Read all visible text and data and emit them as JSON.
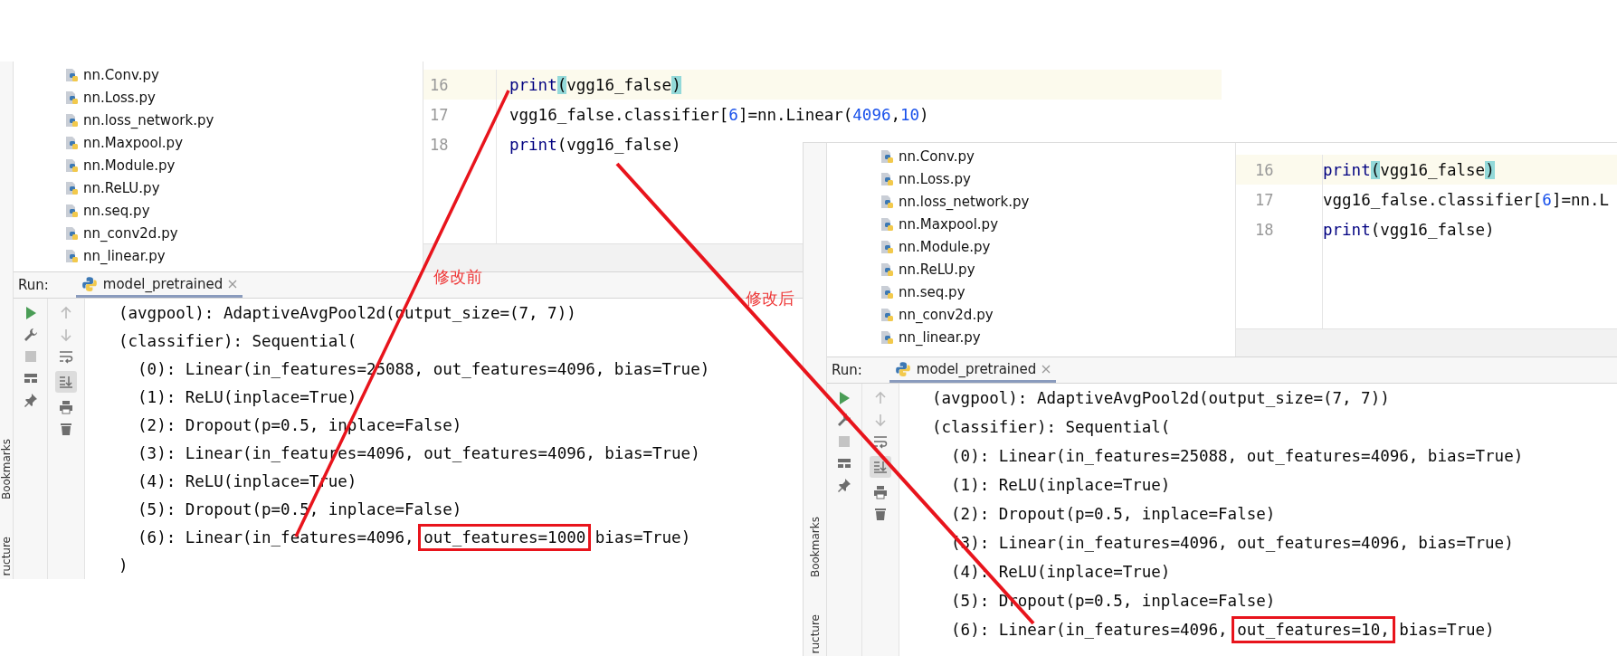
{
  "panels": [
    {
      "project_files": [
        {
          "name": "nn.Conv.py"
        },
        {
          "name": "nn.Loss.py"
        },
        {
          "name": "nn.loss_network.py"
        },
        {
          "name": "nn.Maxpool.py"
        },
        {
          "name": "nn.Module.py"
        },
        {
          "name": "nn.ReLU.py"
        },
        {
          "name": "nn.seq.py"
        },
        {
          "name": "nn_conv2d.py"
        },
        {
          "name": "nn_linear.py"
        }
      ],
      "editor": {
        "lines": [
          {
            "number": "16",
            "current": true,
            "tokens": [
              {
                "text": "print",
                "kind": "builtin"
              },
              {
                "text": "(",
                "kind": "brace"
              },
              {
                "text": "vgg16_false",
                "kind": "plain"
              },
              {
                "text": ")",
                "kind": "brace"
              }
            ]
          },
          {
            "number": "17",
            "current": false,
            "tokens": [
              {
                "text": "vgg16_false.classifier[",
                "kind": "plain"
              },
              {
                "text": "6",
                "kind": "number"
              },
              {
                "text": "]=nn.Linear(",
                "kind": "plain"
              },
              {
                "text": "4096",
                "kind": "number"
              },
              {
                "text": ",",
                "kind": "plain"
              },
              {
                "text": "10",
                "kind": "number"
              },
              {
                "text": ")",
                "kind": "plain"
              }
            ]
          },
          {
            "number": "18",
            "current": false,
            "tokens": [
              {
                "text": "print",
                "kind": "builtin"
              },
              {
                "text": "(vgg16_false)",
                "kind": "plain"
              }
            ]
          }
        ]
      },
      "run": {
        "label": "Run:",
        "tabs": [
          {
            "label": "model_pretrained",
            "selected": true
          }
        ],
        "autoscroll_on": true,
        "side_tabs": [
          "Bookmarks",
          "ructure"
        ],
        "console": [
          {
            "segments": [
              {
                "text": "(avgpool): AdaptiveAvgPool2d(output_size=(7, 7))",
                "boxed": false
              }
            ]
          },
          {
            "segments": [
              {
                "text": "(classifier): Sequential(",
                "boxed": false
              }
            ]
          },
          {
            "segments": [
              {
                "text": "  (0): Linear(in_features=25088, out_features=4096, bias=True)",
                "boxed": false
              }
            ]
          },
          {
            "segments": [
              {
                "text": "  (1): ReLU(inplace=True)",
                "boxed": false
              }
            ]
          },
          {
            "segments": [
              {
                "text": "  (2): Dropout(p=0.5, inplace=False)",
                "boxed": false
              }
            ]
          },
          {
            "segments": [
              {
                "text": "  (3): Linear(in_features=4096, out_features=4096, bias=True)",
                "boxed": false
              }
            ]
          },
          {
            "segments": [
              {
                "text": "  (4): ReLU(inplace=True)",
                "boxed": false
              }
            ]
          },
          {
            "segments": [
              {
                "text": "  (5): Dropout(p=0.5, inplace=False)",
                "boxed": false
              }
            ]
          },
          {
            "segments": [
              {
                "text": "  (6): Linear(in_features=4096, ",
                "boxed": false
              },
              {
                "text": "out_features=1000",
                "boxed": true
              },
              {
                "text": " bias=True)",
                "boxed": false
              }
            ]
          },
          {
            "segments": [
              {
                "text": ")",
                "boxed": false
              }
            ]
          }
        ]
      }
    },
    {
      "project_files": [
        {
          "name": "nn.Conv.py"
        },
        {
          "name": "nn.Loss.py"
        },
        {
          "name": "nn.loss_network.py"
        },
        {
          "name": "nn.Maxpool.py"
        },
        {
          "name": "nn.Module.py"
        },
        {
          "name": "nn.ReLU.py"
        },
        {
          "name": "nn.seq.py"
        },
        {
          "name": "nn_conv2d.py"
        },
        {
          "name": "nn_linear.py"
        }
      ],
      "editor": {
        "lines": [
          {
            "number": "16",
            "current": true,
            "tokens": [
              {
                "text": "print",
                "kind": "builtin"
              },
              {
                "text": "(",
                "kind": "brace"
              },
              {
                "text": "vgg16_false",
                "kind": "plain"
              },
              {
                "text": ")",
                "kind": "brace"
              }
            ]
          },
          {
            "number": "17",
            "current": false,
            "tokens": [
              {
                "text": "vgg16_false.classifier[",
                "kind": "plain"
              },
              {
                "text": "6",
                "kind": "number"
              },
              {
                "text": "]=nn.L",
                "kind": "plain"
              }
            ]
          },
          {
            "number": "18",
            "current": false,
            "tokens": [
              {
                "text": "print",
                "kind": "builtin"
              },
              {
                "text": "(vgg16_false)",
                "kind": "plain"
              }
            ]
          }
        ]
      },
      "run": {
        "label": "Run:",
        "tabs": [
          {
            "label": "model_pretrained",
            "selected": true
          }
        ],
        "autoscroll_on": true,
        "side_tabs": [
          "Bookmarks",
          "ructure"
        ],
        "console": [
          {
            "segments": [
              {
                "text": "(avgpool): AdaptiveAvgPool2d(output_size=(7, 7))",
                "boxed": false
              }
            ]
          },
          {
            "segments": [
              {
                "text": "(classifier): Sequential(",
                "boxed": false
              }
            ]
          },
          {
            "segments": [
              {
                "text": "  (0): Linear(in_features=25088, out_features=4096, bias=True)",
                "boxed": false
              }
            ]
          },
          {
            "segments": [
              {
                "text": "  (1): ReLU(inplace=True)",
                "boxed": false
              }
            ]
          },
          {
            "segments": [
              {
                "text": "  (2): Dropout(p=0.5, inplace=False)",
                "boxed": false
              }
            ]
          },
          {
            "segments": [
              {
                "text": "  (3): Linear(in_features=4096, out_features=4096, bias=True)",
                "boxed": false
              }
            ]
          },
          {
            "segments": [
              {
                "text": "  (4): ReLU(inplace=True)",
                "boxed": false
              }
            ]
          },
          {
            "segments": [
              {
                "text": "  (5): Dropout(p=0.5, inplace=False)",
                "boxed": false
              }
            ]
          },
          {
            "segments": [
              {
                "text": "  (6): Linear(in_features=4096, ",
                "boxed": false
              },
              {
                "text": "out_features=10,",
                "boxed": true
              },
              {
                "text": " bias=True)",
                "boxed": false
              }
            ]
          }
        ]
      }
    }
  ],
  "annotations": [
    {
      "text": "修改前"
    },
    {
      "text": "修改后"
    }
  ]
}
